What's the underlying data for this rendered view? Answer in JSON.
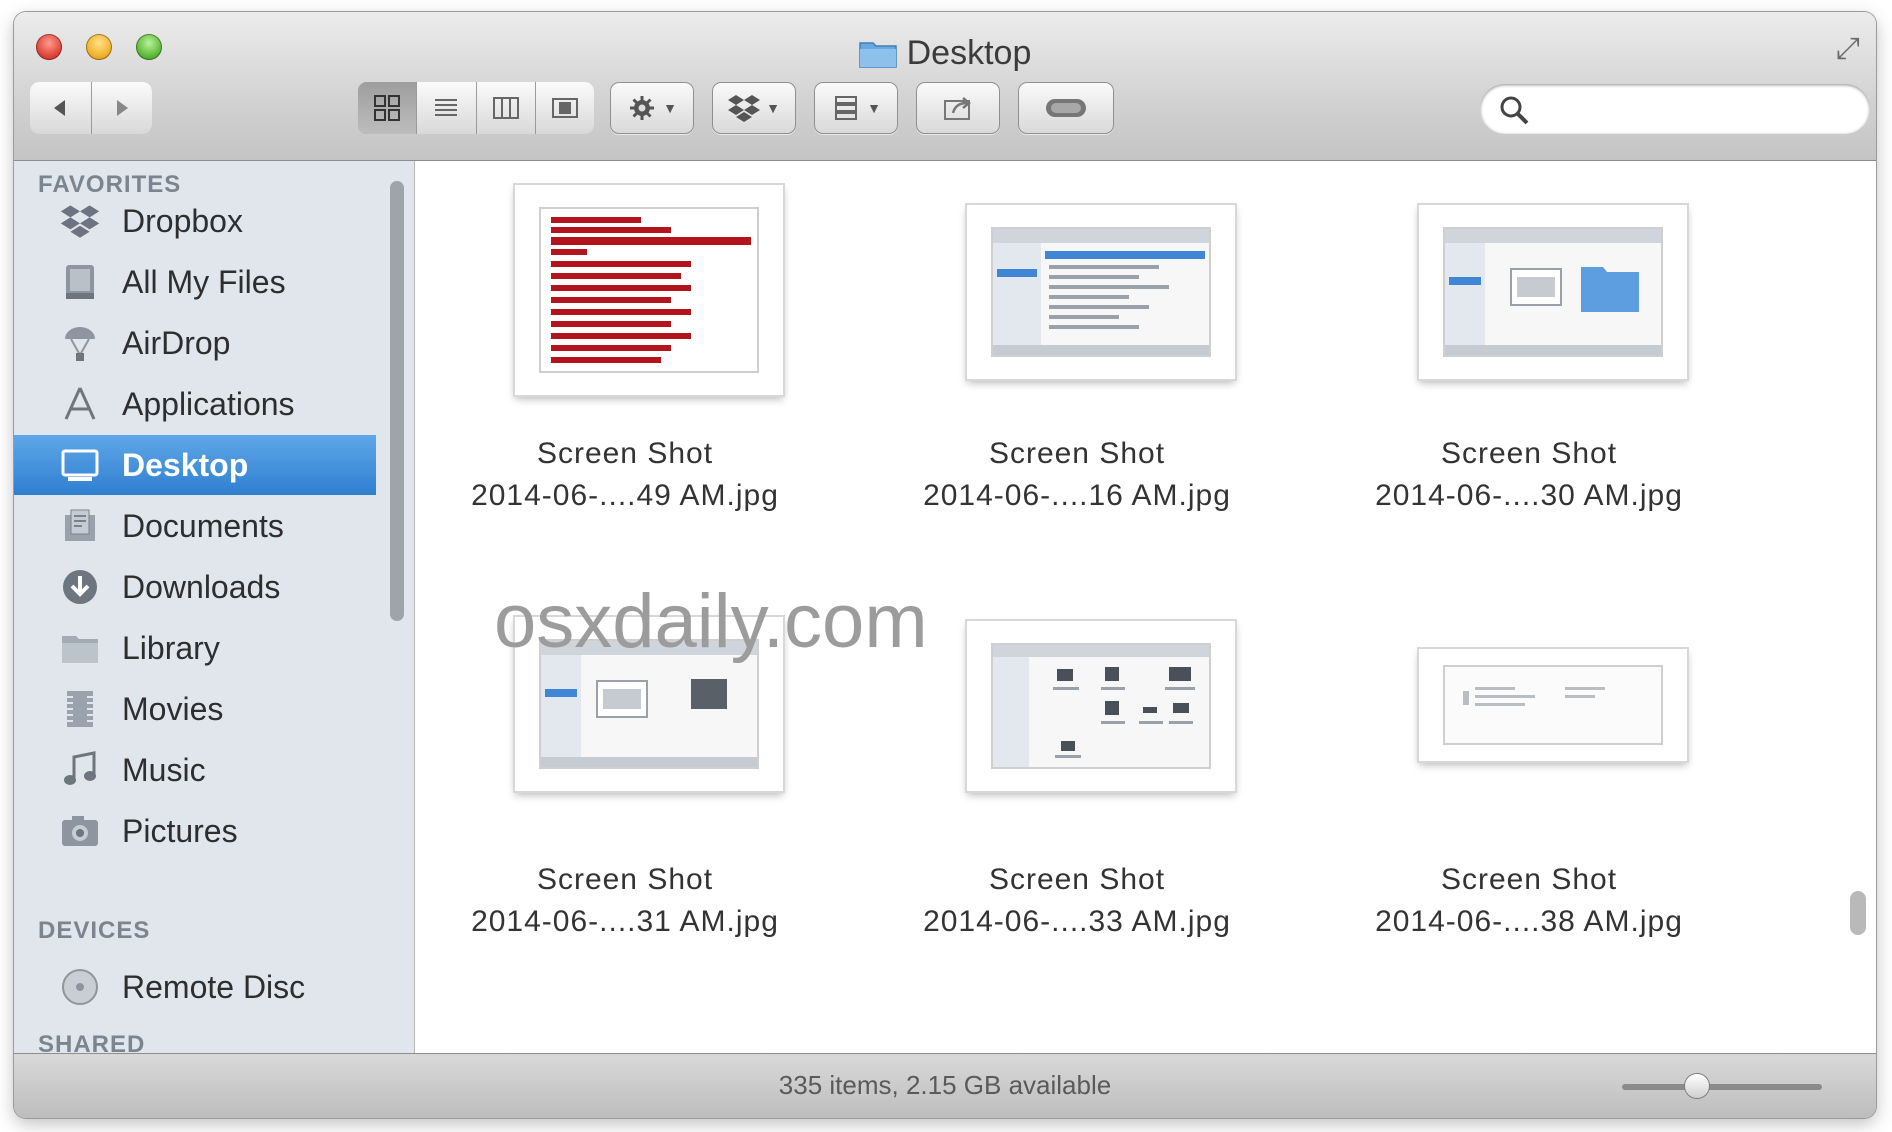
{
  "window": {
    "title": "Desktop"
  },
  "toolbar": {
    "back_icon": "chevron-left-icon",
    "forward_icon": "chevron-right-icon",
    "view_modes": [
      "icon-view-icon",
      "list-view-icon",
      "column-view-icon",
      "cover-flow-icon"
    ],
    "active_view": "icon-view-icon",
    "action_icon": "gear-icon",
    "dropbox_icon": "dropbox-icon",
    "arrange_icon": "arrange-icon",
    "share_icon": "share-icon",
    "tags_icon": "tag-icon",
    "search_placeholder": ""
  },
  "sidebar": {
    "favorites_header": "FAVORITES",
    "favorites": [
      {
        "label": "Dropbox",
        "icon": "dropbox-icon"
      },
      {
        "label": "All My Files",
        "icon": "all-my-files-icon"
      },
      {
        "label": "AirDrop",
        "icon": "airdrop-icon"
      },
      {
        "label": "Applications",
        "icon": "applications-icon"
      },
      {
        "label": "Desktop",
        "icon": "desktop-icon",
        "selected": true
      },
      {
        "label": "Documents",
        "icon": "documents-icon"
      },
      {
        "label": "Downloads",
        "icon": "downloads-icon"
      },
      {
        "label": "Library",
        "icon": "folder-icon"
      },
      {
        "label": "Movies",
        "icon": "movies-icon"
      },
      {
        "label": "Music",
        "icon": "music-icon"
      },
      {
        "label": "Pictures",
        "icon": "pictures-icon"
      }
    ],
    "devices_header": "DEVICES",
    "devices": [
      {
        "label": "Remote Disc",
        "icon": "remote-disc-icon"
      }
    ],
    "shared_header": "SHARED"
  },
  "files": [
    {
      "line1": "Screen Shot",
      "line2": "2014-06-....49 AM.jpg"
    },
    {
      "line1": "Screen Shot",
      "line2": "2014-06-....16 AM.jpg"
    },
    {
      "line1": "Screen Shot",
      "line2": "2014-06-....30 AM.jpg"
    },
    {
      "line1": "Screen Shot",
      "line2": "2014-06-....31 AM.jpg"
    },
    {
      "line1": "Screen Shot",
      "line2": "2014-06-....33 AM.jpg"
    },
    {
      "line1": "Screen Shot",
      "line2": "2014-06-....38 AM.jpg"
    }
  ],
  "watermark": "osxdaily.com",
  "status": {
    "text": "335 items, 2.15 GB available",
    "icon_size_level": 0.36
  },
  "colors": {
    "selection": "#3a86d6",
    "sidebar_bg": "#e0e6ec",
    "folder_blue": "#6aa9e0"
  }
}
